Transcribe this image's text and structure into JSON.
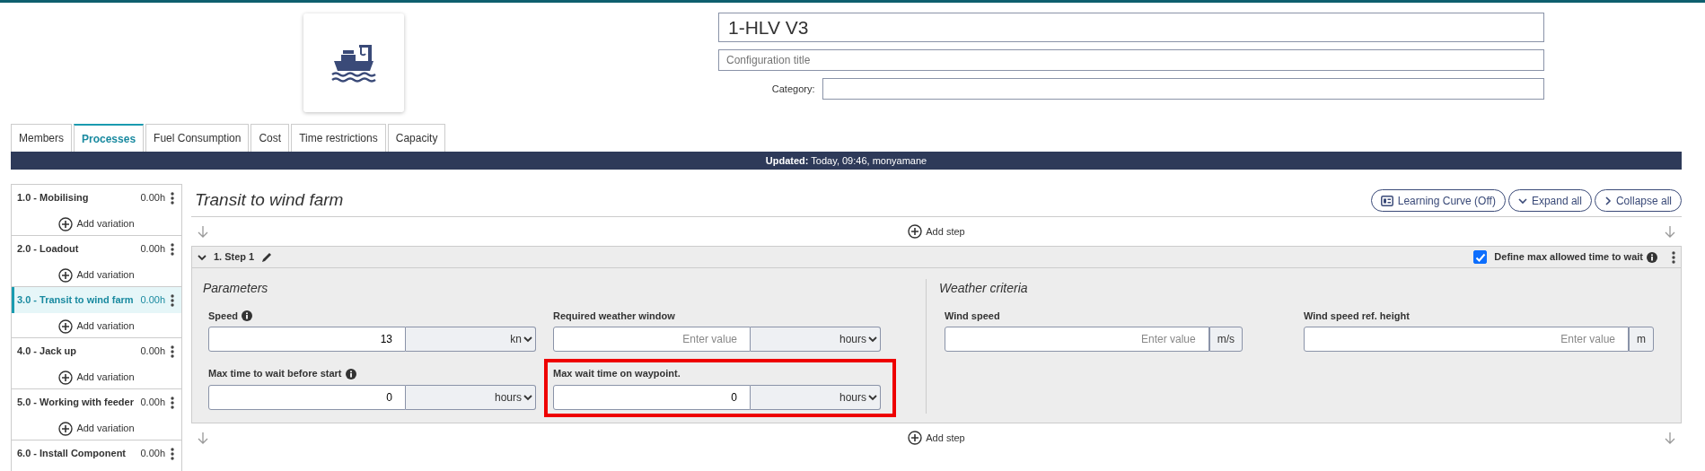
{
  "header": {
    "title_value": "1-HLV V3",
    "subtitle_placeholder": "Configuration title",
    "category_label": "Category:"
  },
  "tabs": [
    {
      "label": "Members",
      "selected": false
    },
    {
      "label": "Processes",
      "selected": true
    },
    {
      "label": "Fuel Consumption",
      "selected": false
    },
    {
      "label": "Cost",
      "selected": false
    },
    {
      "label": "Time restrictions",
      "selected": false
    },
    {
      "label": "Capacity",
      "selected": false
    }
  ],
  "update_bar": "**Updated:** Today, 09:46, monyamane",
  "processes": [
    {
      "label": "1.0 - Mobilising",
      "duration": "0.00h",
      "selected": false,
      "add_label": "Add variation"
    },
    {
      "label": "2.0 - Loadout",
      "duration": "0.00h",
      "selected": false,
      "add_label": "Add variation"
    },
    {
      "label": "3.0 - Transit to wind farm",
      "duration": "0.00h",
      "selected": true,
      "add_label": "Add variation"
    },
    {
      "label": "4.0 - Jack up",
      "duration": "0.00h",
      "selected": false,
      "add_label": "Add variation"
    },
    {
      "label": "5.0 - Working with feeder",
      "duration": "0.00h",
      "selected": false,
      "add_label": "Add variation"
    },
    {
      "label": "6.0 - Install Component",
      "duration": "0.00h",
      "selected": false
    }
  ],
  "main": {
    "title": "Transit to wind farm",
    "buttons": [
      {
        "kind": "learning",
        "label": "Learning Curve (Off)"
      },
      {
        "kind": "expand",
        "label": "Expand all"
      },
      {
        "kind": "collapse",
        "label": "Collapse all"
      }
    ],
    "add_step_top": "Add step",
    "add_step_bottom": "Add step",
    "step": {
      "title": "1. Step 1",
      "expanded": true,
      "max_wait_label": "Define max allowed time to wait",
      "max_wait_checked": true,
      "parameters": {
        "heading": "Parameters",
        "fields": [
          {
            "kind": "select",
            "label": "Speed",
            "info": true,
            "value": "13",
            "unit": "kn",
            "highlighted": false
          },
          {
            "kind": "select",
            "label": "Required weather window",
            "info": false,
            "placeholder": "Enter value",
            "unit": "hours",
            "highlighted": false
          },
          {
            "kind": "select",
            "label": "Max time to wait before start",
            "info": true,
            "value": "0",
            "unit": "hours",
            "highlighted": false
          },
          {
            "kind": "select",
            "label": "Max wait time on waypoint.",
            "info": false,
            "value": "0",
            "unit": "hours",
            "highlighted": true
          }
        ]
      },
      "weather": {
        "heading": "Weather criteria",
        "fields": [
          {
            "kind": "addon",
            "label": "Wind speed",
            "info": false,
            "placeholder": "Enter value",
            "unit": "m/s",
            "highlighted": false
          },
          {
            "kind": "addon",
            "label": "Wind speed ref. height",
            "info": false,
            "placeholder": "Enter value",
            "unit": "m",
            "highlighted": false
          }
        ]
      }
    }
  }
}
